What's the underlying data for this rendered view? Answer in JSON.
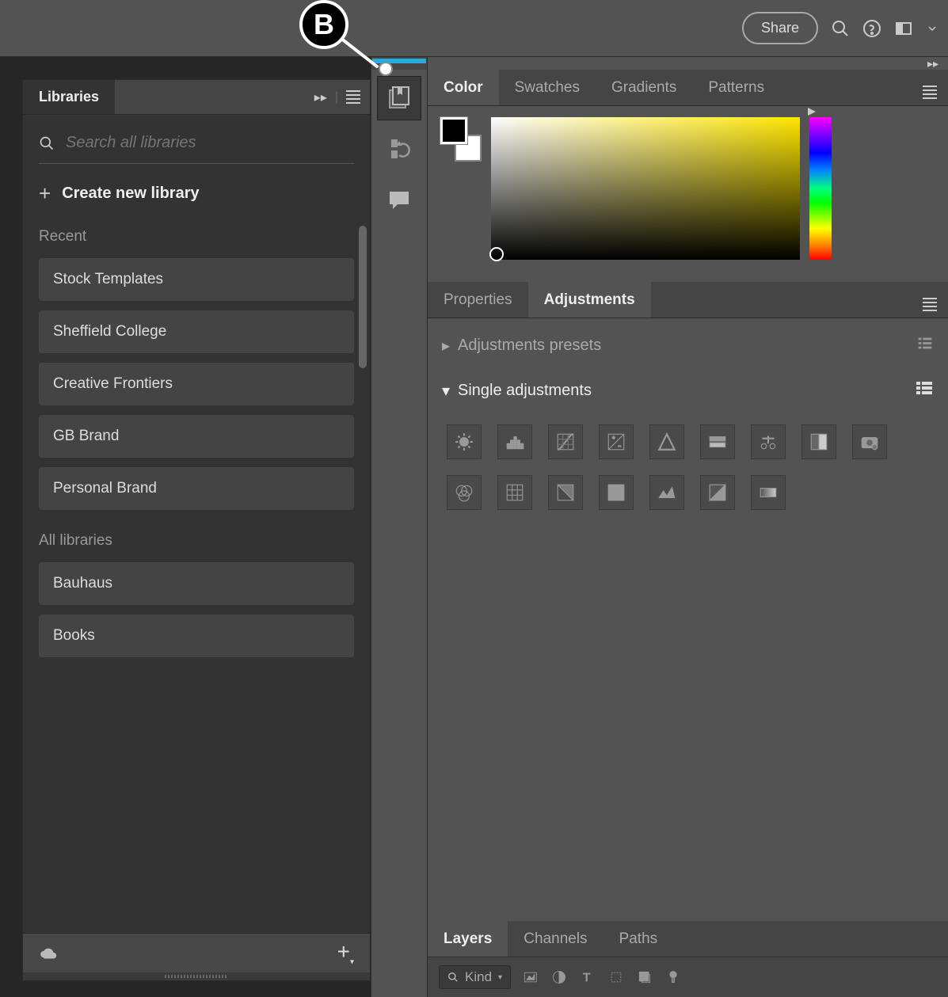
{
  "annotation": {
    "label": "B"
  },
  "topbar": {
    "share_label": "Share"
  },
  "libraries": {
    "tab_label": "Libraries",
    "search_placeholder": "Search all libraries",
    "create_label": "Create new library",
    "recent_label": "Recent",
    "recent_items": [
      "Stock Templates",
      "Sheffield College",
      "Creative Frontiers",
      "GB Brand",
      "Personal Brand"
    ],
    "all_label": "All libraries",
    "all_items": [
      "Bauhaus",
      "Books"
    ]
  },
  "color_panel": {
    "tabs": [
      "Color",
      "Swatches",
      "Gradients",
      "Patterns"
    ],
    "active_tab": "Color"
  },
  "props_panel": {
    "tabs": [
      "Properties",
      "Adjustments"
    ],
    "active_tab": "Adjustments",
    "presets_label": "Adjustments presets",
    "single_label": "Single adjustments",
    "adjustments": [
      "brightness-contrast",
      "levels",
      "curves",
      "exposure",
      "vibrance",
      "hue-saturation",
      "color-balance",
      "black-white",
      "photo-filter",
      "channel-mixer",
      "color-lookup",
      "invert",
      "posterize",
      "threshold",
      "gradient-map",
      "selective-color"
    ]
  },
  "layers_panel": {
    "tabs": [
      "Layers",
      "Channels",
      "Paths"
    ],
    "active_tab": "Layers",
    "kind_label": "Kind"
  }
}
